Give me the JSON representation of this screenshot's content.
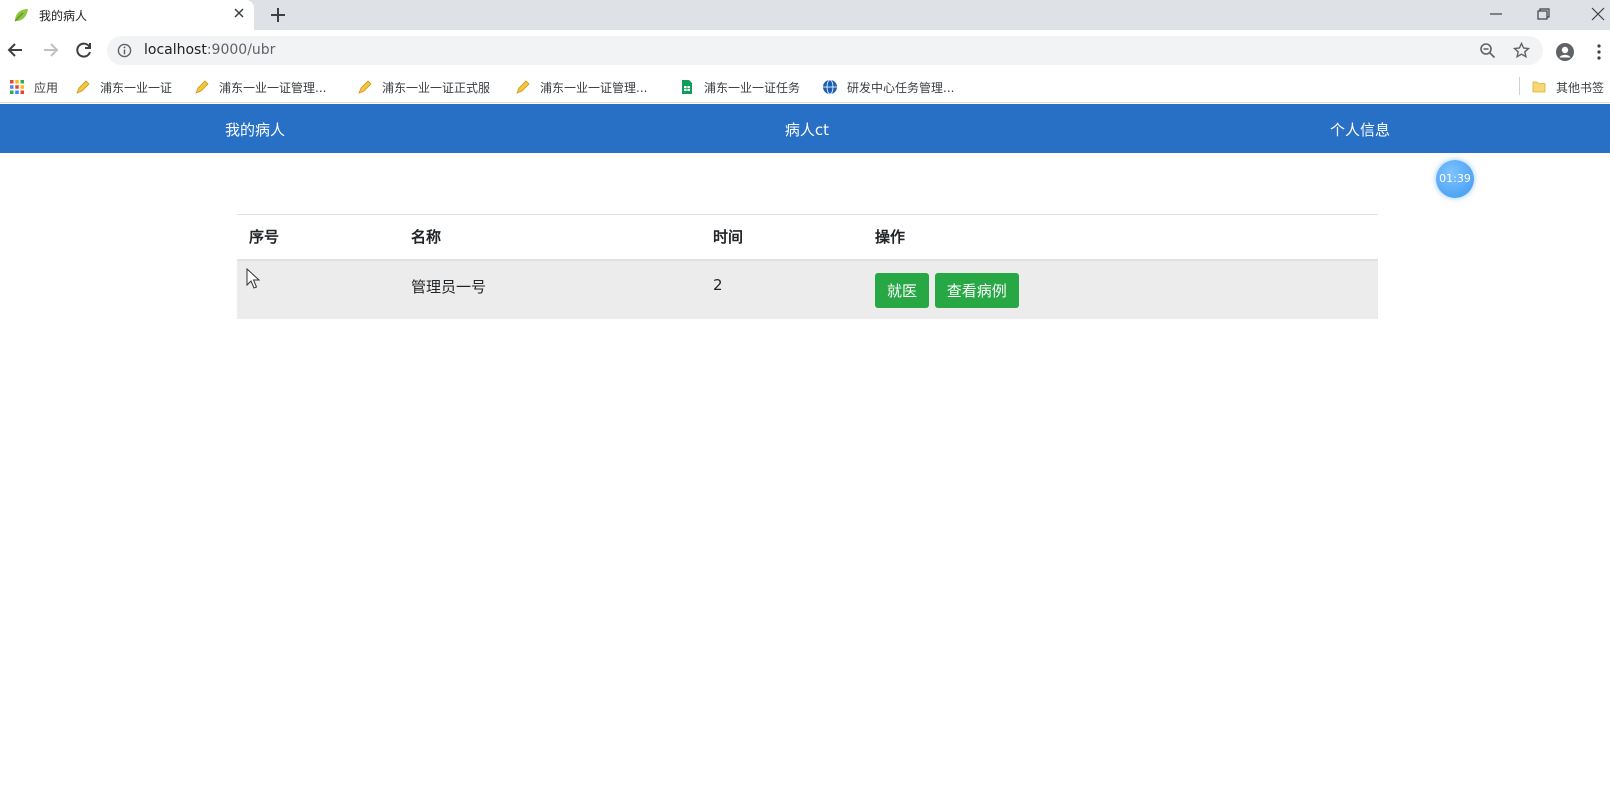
{
  "browser": {
    "tab_title": "我的病人",
    "url_host": "localhost",
    "url_path": ":9000/ubr",
    "bookmarks": [
      {
        "label": "应用",
        "icon": "apps-grid-icon"
      },
      {
        "label": "浦东一业一证",
        "icon": "pen-icon"
      },
      {
        "label": "浦东一业一证管理...",
        "icon": "pen-icon"
      },
      {
        "label": "浦东一业一证正式服",
        "icon": "pen-icon"
      },
      {
        "label": "浦东一业一证管理...",
        "icon": "pen-icon"
      },
      {
        "label": "浦东一业一证任务",
        "icon": "sheets-icon"
      },
      {
        "label": "研发中心任务管理...",
        "icon": "globe-icon"
      }
    ],
    "other_bookmarks": "其他书签"
  },
  "nav": {
    "items": [
      {
        "label": "我的病人"
      },
      {
        "label": "病人ct"
      },
      {
        "label": "个人信息"
      }
    ]
  },
  "timer": "01:39",
  "table": {
    "headers": [
      "序号",
      "名称",
      "时间",
      "操作"
    ],
    "rows": [
      {
        "index": "",
        "name": "管理员一号",
        "time": "2",
        "actions": [
          "就医",
          "查看病例"
        ]
      }
    ]
  },
  "colors": {
    "navbar": "#2770c6",
    "button": "#28a745",
    "row": "#ececec"
  }
}
